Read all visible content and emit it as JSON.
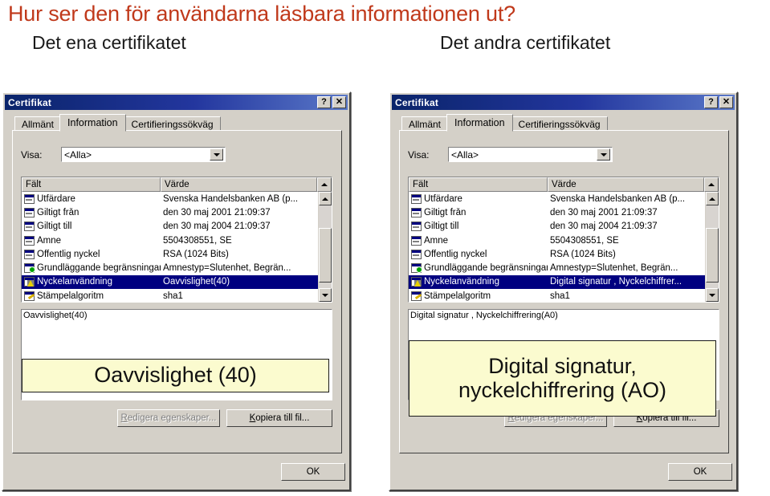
{
  "slide": {
    "title": "Hur ser den för användarna läsbara informationen ut?",
    "title_color": "#c0391b",
    "left_caption": "Det ena certifikatet",
    "right_caption": "Det andra certifikatet"
  },
  "dialog_common": {
    "window_title": "Certifikat",
    "help_button": "?",
    "close_button": "✕",
    "tabs": [
      {
        "label": "Allmänt",
        "active": false
      },
      {
        "label": "Information",
        "active": true
      },
      {
        "label": "Certifieringssökväg",
        "active": false
      }
    ],
    "show_label": "Visa:",
    "show_value": "<Alla>",
    "columns": {
      "field": "Fält",
      "value": "Värde"
    },
    "buttons": {
      "edit_properties": "Redigera egenskaper...",
      "edit_properties_enabled": false,
      "copy_to_file": "Kopiera till fil...",
      "ok": "OK"
    },
    "selection_color": "#000080",
    "callout_color": "#fbfbcf"
  },
  "left_dialog": {
    "rows": [
      {
        "icon": "certificate-field-icon",
        "field": "Utfärdare",
        "value": "Svenska Handelsbanken AB (p...",
        "selected": false
      },
      {
        "icon": "certificate-field-icon",
        "field": "Giltigt från",
        "value": "den 30 maj 2001 21:09:37",
        "selected": false
      },
      {
        "icon": "certificate-field-icon",
        "field": "Giltigt till",
        "value": "den 30 maj 2004 21:09:37",
        "selected": false
      },
      {
        "icon": "certificate-field-icon",
        "field": "Ämne",
        "value": "5504308551, SE",
        "selected": false
      },
      {
        "icon": "certificate-field-icon",
        "field": "Offentlig nyckel",
        "value": "RSA (1024 Bits)",
        "selected": false
      },
      {
        "icon": "green-plus-field-icon",
        "field": "Grundläggande begränsningar",
        "value": "Ämnestyp=Slutenhet, Begrän...",
        "selected": false
      },
      {
        "icon": "warning-field-icon",
        "field": "Nyckelanvändning",
        "value": "Oavvislighet(40)",
        "selected": true
      },
      {
        "icon": "pencil-field-icon",
        "field": "Stämpelalgoritm",
        "value": "sha1",
        "selected": false
      }
    ],
    "detail_text": "Oavvislighet(40)",
    "callout_text": "Oavvislighet (40)"
  },
  "right_dialog": {
    "rows": [
      {
        "icon": "certificate-field-icon",
        "field": "Utfärdare",
        "value": "Svenska Handelsbanken AB (p...",
        "selected": false
      },
      {
        "icon": "certificate-field-icon",
        "field": "Giltigt från",
        "value": "den 30 maj 2001 21:09:37",
        "selected": false
      },
      {
        "icon": "certificate-field-icon",
        "field": "Giltigt till",
        "value": "den 30 maj 2004 21:09:37",
        "selected": false
      },
      {
        "icon": "certificate-field-icon",
        "field": "Ämne",
        "value": "5504308551, SE",
        "selected": false
      },
      {
        "icon": "certificate-field-icon",
        "field": "Offentlig nyckel",
        "value": "RSA (1024 Bits)",
        "selected": false
      },
      {
        "icon": "green-plus-field-icon",
        "field": "Grundläggande begränsningar",
        "value": "Ämnestyp=Slutenhet, Begrän...",
        "selected": false
      },
      {
        "icon": "warning-field-icon",
        "field": "Nyckelanvändning",
        "value": "Digital signatur , Nyckelchiffrer...",
        "selected": true
      },
      {
        "icon": "pencil-field-icon",
        "field": "Stämpelalgoritm",
        "value": "sha1",
        "selected": false
      }
    ],
    "detail_text": "Digital signatur , Nyckelchiffrering(A0)",
    "callout_text": "Digital signatur, nyckelchiffrering (AO)"
  }
}
